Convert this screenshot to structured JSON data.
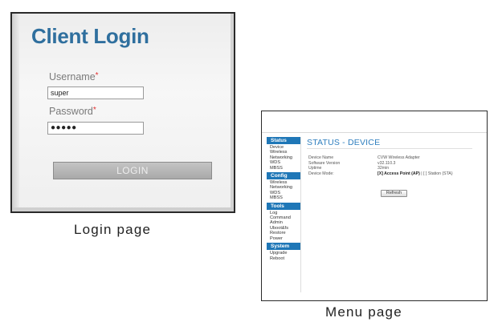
{
  "login": {
    "title": "Client Login",
    "username_label": "Username",
    "username_value": "super",
    "password_label": "Password",
    "password_value": "●●●●●",
    "required_marker": "*",
    "login_button": "LOGIN",
    "caption": "Login page"
  },
  "menu": {
    "caption": "Menu page",
    "page_title": "STATUS - DEVICE",
    "sections": [
      {
        "title": "Status",
        "items": [
          "Device",
          "Wireless",
          "Networking",
          "WDS",
          "MBSS"
        ]
      },
      {
        "title": "Config",
        "items": [
          "Wireless",
          "Networking",
          "WDS",
          "MBSS"
        ]
      },
      {
        "title": "Tools",
        "items": [
          "Log",
          "Command",
          "Admin",
          "Uboot&fs",
          "Restore",
          "Power"
        ]
      },
      {
        "title": "System",
        "items": [
          "Upgrade",
          "Reboot"
        ]
      }
    ],
    "info": [
      {
        "key": "Device Name",
        "value": "CVW Wireless Adapter"
      },
      {
        "key": "Software Version",
        "value": "v32.110.3"
      },
      {
        "key": "Uptime",
        "value": "32min"
      }
    ],
    "device_mode_label": "Device Mode:",
    "device_mode_selected": "[X] Access Point (AP)",
    "device_mode_other": " | [ ] Station (STA)",
    "refresh_button": "Refresh"
  },
  "colors": {
    "login_title": "#2f6f9e",
    "menu_header": "#1f77b7",
    "status_title": "#2f7fbf",
    "required": "#e03030"
  }
}
